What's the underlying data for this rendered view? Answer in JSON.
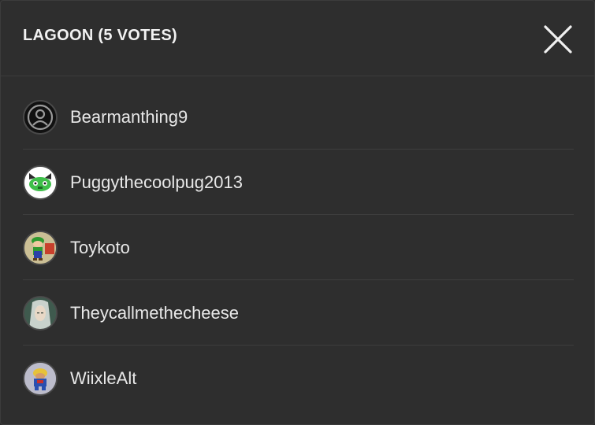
{
  "modal": {
    "title": "LAGOON (5 VOTES)",
    "close_icon": "close-icon"
  },
  "voters": [
    {
      "name": "Bearmanthing9",
      "avatar": "default-user-icon"
    },
    {
      "name": "Puggythecoolpug2013",
      "avatar": "green-pug-avatar"
    },
    {
      "name": "Toykoto",
      "avatar": "luigi-avatar"
    },
    {
      "name": "Theycallmethecheese",
      "avatar": "silver-hair-character-avatar"
    },
    {
      "name": "WiixleAlt",
      "avatar": "blue-character-avatar"
    }
  ],
  "colors": {
    "background": "#2e2e2e",
    "divider": "#3e3e3e",
    "text": "#e8e8e8"
  }
}
